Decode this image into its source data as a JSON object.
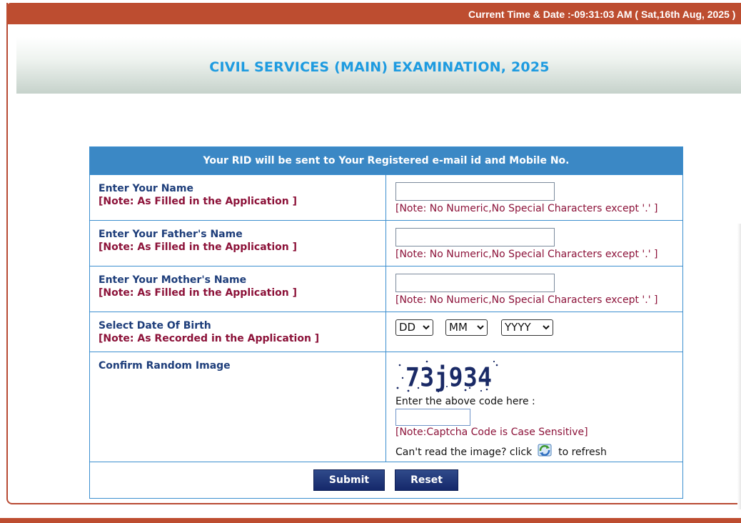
{
  "header": {
    "clock_text": "Current Time & Date :-09:31:03 AM ( Sat,16th Aug, 2025 )"
  },
  "banner": {
    "title": "CIVIL SERVICES (MAIN) EXAMINATION, 2025"
  },
  "form": {
    "header": "Your RID will be sent to Your Registered e-mail id and Mobile No.",
    "name": {
      "label": "Enter Your Name",
      "note": "[Note: As Filled in the Application ]",
      "value": "",
      "field_note": "[Note: No Numeric,No Special Characters except '.' ]"
    },
    "father_name": {
      "label": "Enter Your Father's Name",
      "note": "[Note: As Filled in the Application ]",
      "value": "",
      "field_note": "[Note: No Numeric,No Special Characters except '.' ]"
    },
    "mother_name": {
      "label": "Enter Your Mother's Name",
      "note": "[Note: As Filled in the Application ]",
      "value": "",
      "field_note": "[Note: No Numeric,No Special Characters except '.' ]"
    },
    "dob": {
      "label": "Select Date Of Birth",
      "note": "[Note: As Recorded in the Application ]",
      "day": "DD",
      "month": "MM",
      "year": "YYYY"
    },
    "captcha": {
      "label": "Confirm Random Image",
      "image_text": "73j934",
      "code_label": "Enter the above code here :",
      "value": "",
      "case_note": "[Note:Captcha Code is Case Sensitive]",
      "refresh_prefix": "Can't read the image? click",
      "refresh_suffix": "to refresh",
      "refresh_icon": "refresh-icon"
    },
    "submit_label": "Submit",
    "reset_label": "Reset"
  },
  "colors": {
    "topbar": "#bd4d30",
    "banner_title": "#1e9be0",
    "form_header": "#3b88c5",
    "label": "#1d3d7a",
    "note": "#8c1239",
    "button": "#1c3275"
  }
}
